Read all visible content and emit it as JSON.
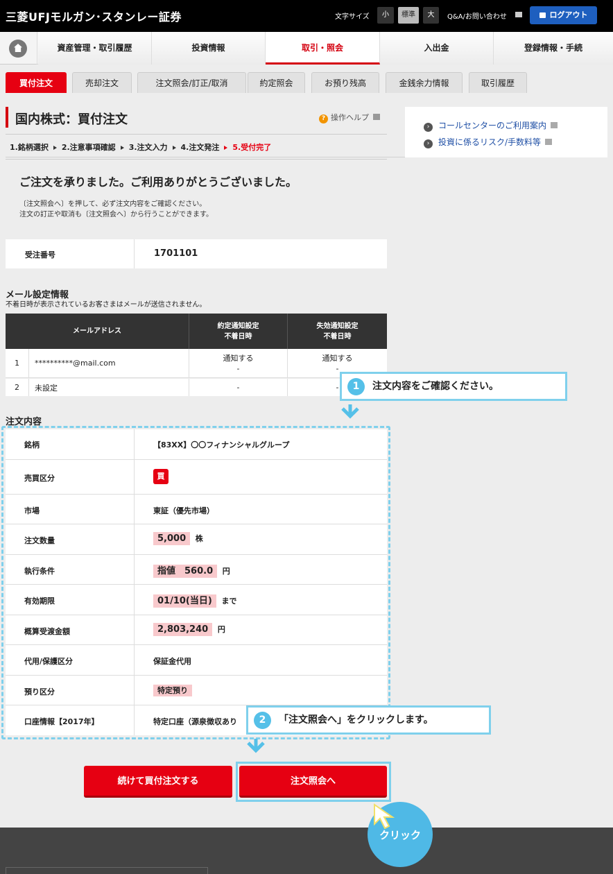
{
  "header": {
    "logo": "三菱UFJモルガン･スタンレー証券",
    "font_size_label": "文字サイズ",
    "font_sizes": [
      "小",
      "標準",
      "大"
    ],
    "qa_link": "Q&A/お問い合わせ",
    "logout": "ログアウト"
  },
  "nav": {
    "items": [
      "資産管理・取引履歴",
      "投資情報",
      "取引・照会",
      "入出金",
      "登録情報・手続"
    ]
  },
  "subtabs": [
    "買付注文",
    "売却注文",
    "注文照会/訂正/取消",
    "約定照会",
    "お預り残高",
    "金銭余力情報",
    "取引履歴"
  ],
  "page": {
    "title": "国内株式：買付注文",
    "help": "操作ヘルプ",
    "steps": [
      "1.銘柄選択",
      "2.注意事項確認",
      "3.注文入力",
      "4.注文発注",
      "5.受付完了"
    ],
    "done_message": "ご注文を承りました。ご利用ありがとうございました。",
    "note_line1": "〔注文照会へ〕を押して、必ず注文内容をご確認ください。",
    "note_line2": "注文の訂正や取消も〔注文照会へ〕から行うことができます。",
    "order_no_label": "受注番号",
    "order_no": "1701101"
  },
  "mail": {
    "section_title": "メール設定情報",
    "section_note": "不着日時が表示されているお客さまはメールが送信されません。",
    "headers": {
      "address": "メールアドレス",
      "exec_line1": "約定通知設定",
      "exec_line2": "不着日時",
      "expire_line1": "失効通知設定",
      "expire_line2": "不着日時"
    },
    "rows": [
      {
        "no": "1",
        "address": "**********@mail.com",
        "exec": "通知する",
        "exec_sub": "-",
        "expire": "通知する",
        "expire_sub": "-"
      },
      {
        "no": "2",
        "address": "未設定",
        "exec": "-",
        "expire": "-"
      }
    ]
  },
  "order": {
    "section_title": "注文内容",
    "rows": [
      {
        "label": "銘柄",
        "value": "【83XX】〇〇フィナンシャルグループ"
      },
      {
        "label": "売買区分",
        "value": "買"
      },
      {
        "label": "市場",
        "value": "東証（優先市場）"
      },
      {
        "label": "注文数量",
        "value": "5,000",
        "unit": "株"
      },
      {
        "label": "執行条件",
        "value": "指値　560.0",
        "unit": "円"
      },
      {
        "label": "有効期限",
        "value": "01/10(当日)",
        "unit": "まで"
      },
      {
        "label": "概算受渡金額",
        "value": "2,803,240",
        "unit": "円"
      },
      {
        "label": "代用/保護区分",
        "value": "保証金代用"
      },
      {
        "label": "預り区分",
        "value": "特定預り"
      },
      {
        "label": "口座情報【2017年】",
        "value": "特定口座（源泉徴収あり"
      }
    ]
  },
  "buttons": {
    "continue": "続けて買付注文する",
    "inquiry": "注文照会へ"
  },
  "side": {
    "links": [
      "コールセンターのご利用案内",
      "投資に係るリスク/手数料等"
    ]
  },
  "annotations": {
    "callout1_num": "1",
    "callout1": "注文内容をご確認ください。",
    "callout2_num": "2",
    "callout2": "「注文照会へ」をクリックします。",
    "click": "クリック"
  },
  "colors": {
    "accent_red": "#e60012",
    "annotation_blue": "#7fd0ec",
    "logout_blue": "#1e5fbf"
  }
}
